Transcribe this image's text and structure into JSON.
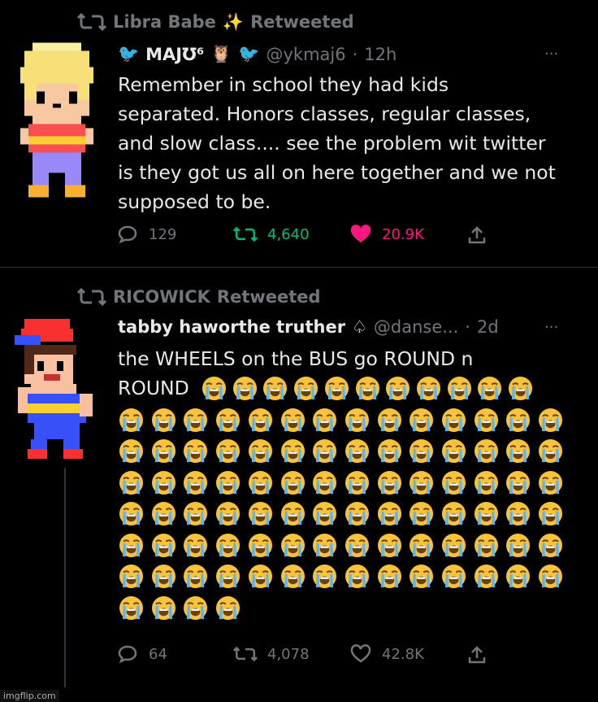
{
  "tweet1": {
    "retweeted_by": "Libra Babe",
    "retweeted_label": "Retweeted",
    "author_name": "MAJƱ⁶",
    "handle": "@ykmaj6",
    "time": "12h",
    "text_lines": [
      "Remember in school they had kids",
      "separated. Honors classes, regular classes,",
      "and slow class.... see the problem wit twitter",
      "is they got us all on here together and we not",
      "supposed to be."
    ],
    "replies": "129",
    "retweets": "4,640",
    "likes": "20.9K",
    "liked": true,
    "more": "···"
  },
  "tweet2": {
    "retweeted_by": "RICOWICK",
    "retweeted_label": "Retweeted",
    "author_name": "tabby haworthe truther",
    "handle": "@danse...",
    "time": "2d",
    "text_lines": [
      "the WHEELS on the BUS go ROUND n",
      "ROUND"
    ],
    "emoji_name": "loudly-crying-face",
    "emoji_count": 99,
    "replies": "64",
    "retweets": "4,078",
    "likes": "42.8K",
    "more": "···"
  },
  "watermark": "imgflip.com",
  "colors": {
    "like_active": "#f91880",
    "retweet_active": "#00ba7c",
    "muted": "#71767b",
    "background": "#000000"
  }
}
